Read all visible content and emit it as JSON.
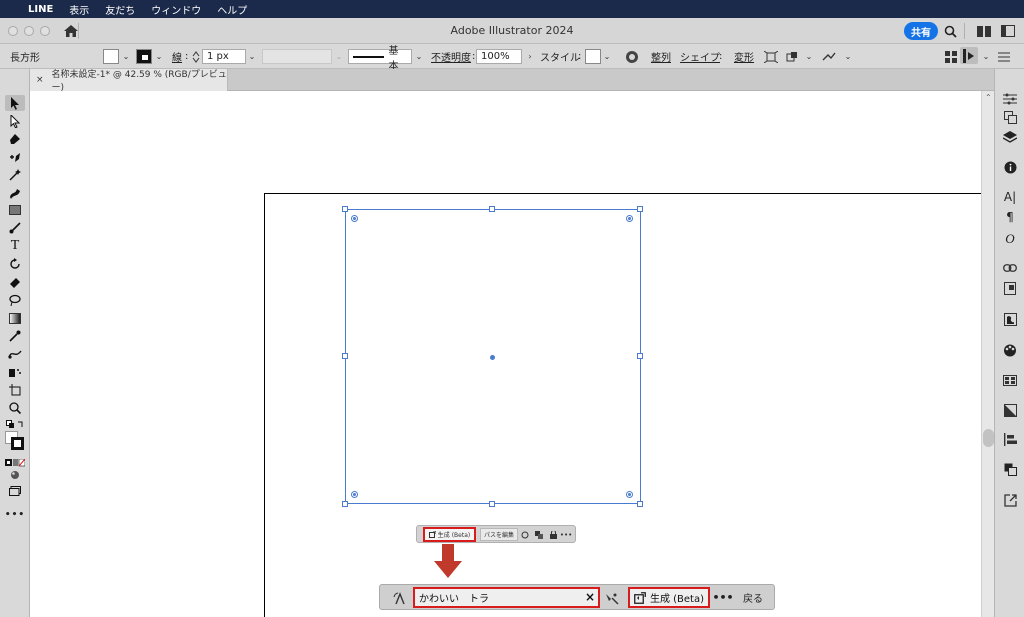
{
  "menubar": {
    "app": "LINE",
    "items": [
      "表示",
      "友だち",
      "ウィンドウ",
      "ヘルプ"
    ]
  },
  "window": {
    "title": "Adobe Illustrator 2024",
    "share": "共有"
  },
  "control_bar": {
    "selection_type": "長方形",
    "stroke_label": "線",
    "stroke_weight": "1 px",
    "brush_label": "基本",
    "opacity_label": "不透明度",
    "opacity_value": "100%",
    "style_label": "スタイル",
    "align_label": "整列",
    "shape_label": "シェイプ",
    "transform_label": "変形"
  },
  "document_tab": {
    "label": "名称未設定-1* @ 42.59 % (RGB/プレビュー)"
  },
  "contextual_task_bar_small": {
    "generate_label": "生成 (Beta)",
    "edit_path_label": "パスを編集",
    "more": "•••"
  },
  "contextual_task_bar": {
    "prompt_value": "かわいい　トラ",
    "generate_label": "生成 (Beta)",
    "more": "•••",
    "back_label": "戻る"
  },
  "colors": {
    "highlight": "#d81b1b",
    "selection": "#4a7bd0",
    "share_button": "#1473e6"
  }
}
